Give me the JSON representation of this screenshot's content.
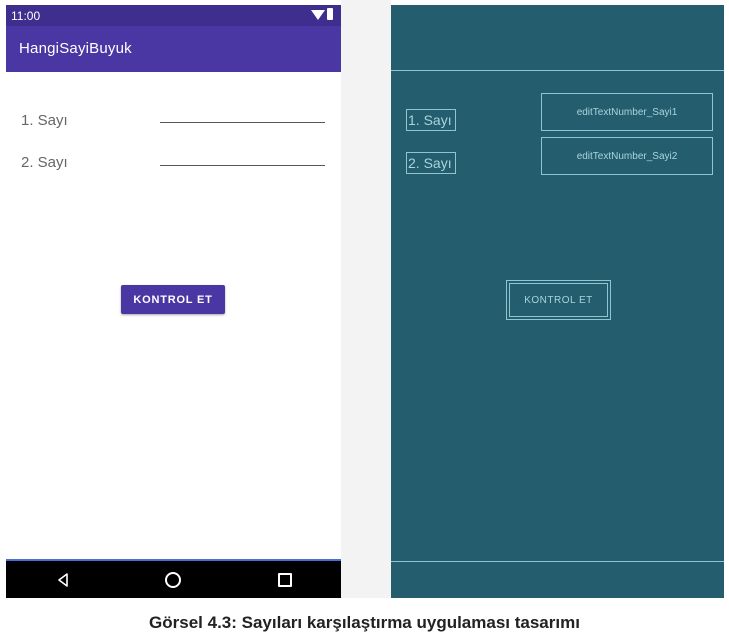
{
  "status_bar": {
    "time": "11:00"
  },
  "app_bar": {
    "title": "HangiSayiBuyuk"
  },
  "form": {
    "label1": "1. Sayı",
    "label2": "2. Sayı",
    "button_label": "KONTROL ET"
  },
  "blueprint": {
    "label1": "1. Sayı",
    "label2": "2. Sayı",
    "edit1_id": "editTextNumber_Sayi1",
    "edit2_id": "editTextNumber_Sayi2",
    "button_label": "KONTROL ET"
  },
  "caption": "Görsel 4.3: Sayıları karşılaştırma uygulaması tasarımı",
  "colors": {
    "primary": "#4b37a3",
    "status_bar": "#3e2e8e",
    "blueprint_bg": "#245d6e",
    "blueprint_line": "#8fc4d0"
  },
  "icons": {
    "status": [
      "wifi-icon",
      "battery-icon"
    ],
    "navigation": [
      "back-icon",
      "home-icon",
      "recents-icon"
    ]
  }
}
